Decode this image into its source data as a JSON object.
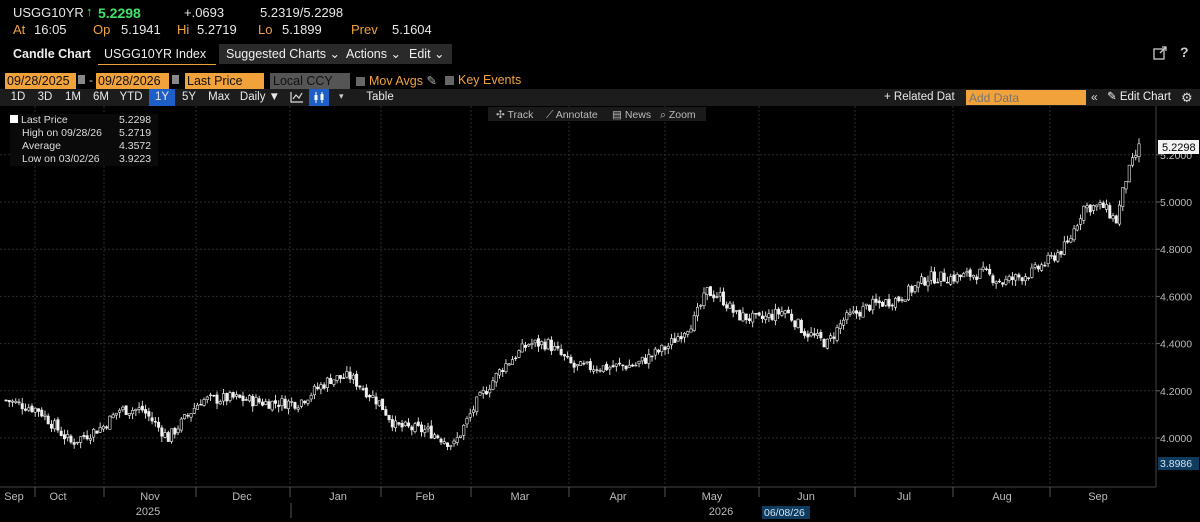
{
  "header": {
    "ticker": "USGG10YR",
    "arrow": "↑",
    "last": "5.2298",
    "change": "+.0693",
    "bid_ask": "5.2319/5.2298",
    "at_label": "At",
    "time": "16:05",
    "op_label": "Op",
    "op": "5.1941",
    "hi_label": "Hi",
    "hi": "5.2719",
    "lo_label": "Lo",
    "lo": "5.1899",
    "prev_label": "Prev",
    "prev": "5.1604"
  },
  "toolbar": {
    "candle_chart": "Candle Chart",
    "security": "USGG10YR Index",
    "suggested": "Suggested Charts ⌄",
    "actions": "Actions ⌄",
    "edit": "Edit ⌄"
  },
  "range": {
    "start": "09/28/2025",
    "dash": "-",
    "end": "09/28/2026",
    "field": "Last Price",
    "ccy": "Local CCY",
    "mov_avgs": "Mov Avgs",
    "key_events": "Key Events"
  },
  "periods": [
    "1D",
    "3D",
    "1M",
    "6M",
    "YTD",
    "1Y",
    "5Y",
    "Max"
  ],
  "selected_period": "1Y",
  "freq": "Daily ▼",
  "table_label": "Table",
  "related": "+ Related Dat",
  "add_data_placeholder": "Add Data",
  "edit_chart": "Edit Chart",
  "tools": {
    "track": "Track",
    "annotate": "Annotate",
    "news": "News",
    "zoom": "Zoom"
  },
  "legend": {
    "last_label": "Last Price",
    "last": "5.2298",
    "high_label": "High on 09/28/26",
    "high": "5.2719",
    "avg_label": "Average",
    "avg": "4.3572",
    "low_label": "Low on 03/02/26",
    "low": "3.9223"
  },
  "colors": {
    "up": "#f2f2f2",
    "down": "#f2f2f2",
    "accent": "#f2a23b",
    "selected": "#1d5fc6"
  },
  "chart_data": {
    "type": "candlestick",
    "ylim": [
      3.83,
      5.29
    ],
    "yticks": [
      "4.0000",
      "4.2000",
      "4.4000",
      "4.6000",
      "4.8000",
      "5.0000",
      "5.2000"
    ],
    "last_label": "5.2298",
    "low_label": "3.8986",
    "months": [
      "Sep",
      "Oct",
      "Nov",
      "Dec",
      "Jan",
      "Feb",
      "Mar",
      "Apr",
      "May",
      "Jun",
      "Jul",
      "Aug",
      "Sep"
    ],
    "years": [
      "2025",
      "2026"
    ],
    "cursor_date": "06/08/26",
    "keypoints": [
      [
        0,
        4.16
      ],
      [
        10,
        4.12
      ],
      [
        20,
        3.98
      ],
      [
        30,
        4.05
      ],
      [
        35,
        4.12
      ],
      [
        42,
        4.12
      ],
      [
        50,
        4.0
      ],
      [
        60,
        4.16
      ],
      [
        70,
        4.17
      ],
      [
        80,
        4.15
      ],
      [
        90,
        4.15
      ],
      [
        95,
        4.2
      ],
      [
        100,
        4.25
      ],
      [
        106,
        4.26
      ],
      [
        115,
        4.15
      ],
      [
        120,
        4.05
      ],
      [
        130,
        4.03
      ],
      [
        138,
        3.97
      ],
      [
        145,
        4.15
      ],
      [
        153,
        4.3
      ],
      [
        161,
        4.4
      ],
      [
        167,
        4.4
      ],
      [
        175,
        4.3
      ],
      [
        185,
        4.3
      ],
      [
        194,
        4.31
      ],
      [
        204,
        4.39
      ],
      [
        212,
        4.5
      ],
      [
        216,
        4.62
      ],
      [
        220,
        4.6
      ],
      [
        225,
        4.52
      ],
      [
        232,
        4.5
      ],
      [
        240,
        4.54
      ],
      [
        246,
        4.45
      ],
      [
        253,
        4.4
      ],
      [
        258,
        4.5
      ],
      [
        266,
        4.56
      ],
      [
        275,
        4.59
      ],
      [
        284,
        4.68
      ],
      [
        292,
        4.68
      ],
      [
        301,
        4.7
      ],
      [
        307,
        4.66
      ],
      [
        316,
        4.7
      ],
      [
        322,
        4.76
      ],
      [
        327,
        4.82
      ],
      [
        332,
        4.98
      ],
      [
        338,
        4.98
      ],
      [
        342,
        4.92
      ],
      [
        345,
        5.1
      ],
      [
        349,
        5.23
      ]
    ]
  }
}
